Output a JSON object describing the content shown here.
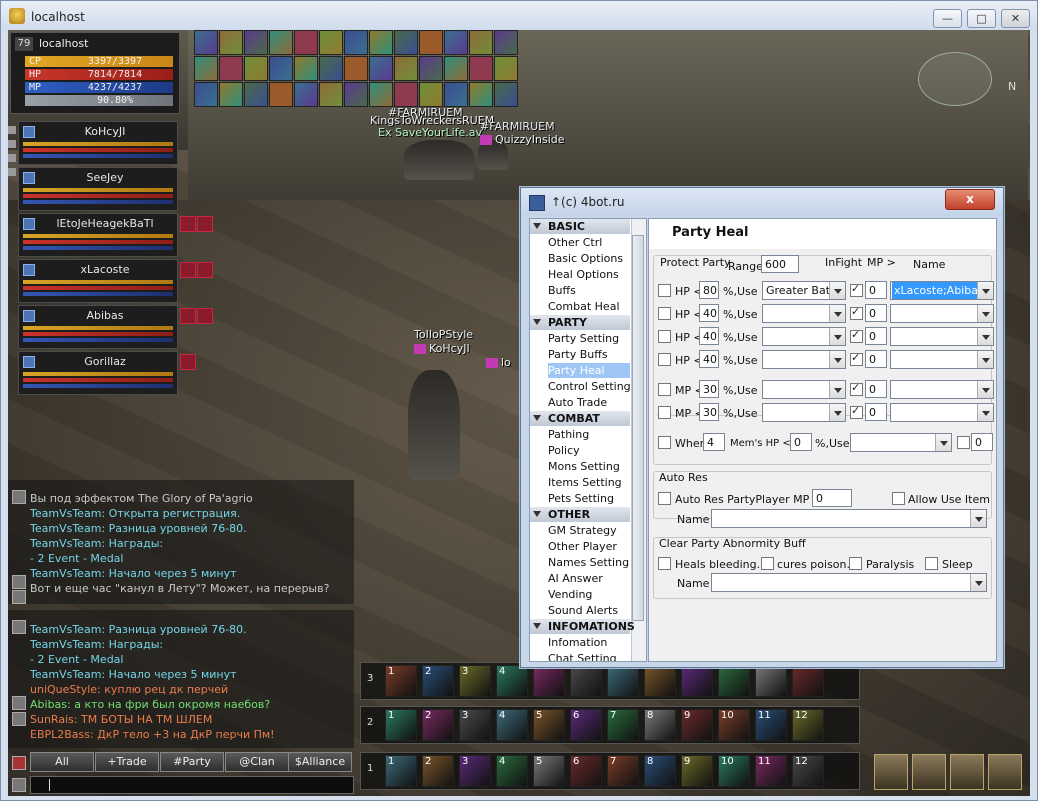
{
  "window": {
    "title": "localhost"
  },
  "status": {
    "level": "79",
    "name": "localhost",
    "cp": {
      "label": "CP",
      "value": "3397/3397"
    },
    "hp": {
      "label": "HP",
      "value": "7814/7814"
    },
    "mp": {
      "label": "MP",
      "value": "4237/4237"
    },
    "exp": {
      "value": "90.80%"
    }
  },
  "party": [
    {
      "name": "KoHcyJI"
    },
    {
      "name": "SeeJey"
    },
    {
      "name": "lEtoJeHeagekBaTl"
    },
    {
      "name": "xLacoste"
    },
    {
      "name": "Abibas"
    },
    {
      "name": "Gorillaz"
    }
  ],
  "world_tags": {
    "t1": "#FARMIRUEM",
    "t2": "KingsToWreckersRUEM",
    "t3": "#FARMIRUEM",
    "t4": "SaveYourLife.av",
    "t5": "QuizzyInside",
    "t6": "ToIIoPStyle",
    "t7": "KoHcyJI",
    "t8": "lo",
    "t9": "Ex"
  },
  "compass": "N",
  "chat_top": [
    {
      "text": "Вы под эффектом The Glory of Pa'agrio",
      "color": "#c9c9c9"
    },
    {
      "text": "TeamVsTeam: Открыта регистрация.",
      "color": "#74d6e8"
    },
    {
      "text": "TeamVsTeam: Разница уровней 76-80.",
      "color": "#74d6e8"
    },
    {
      "text": "TeamVsTeam: Награды:",
      "color": "#74d6e8"
    },
    {
      "text": " - 2 Event - Medal",
      "color": "#74d6e8"
    },
    {
      "text": "TeamVsTeam: Начало через 5 минут",
      "color": "#74d6e8"
    },
    {
      "text": "Вот и еще час \"канул в Лету\"? Может, на перерыв?",
      "color": "#c9c9c9"
    }
  ],
  "chat_bottom": [
    {
      "text": "TeamVsTeam: Разница уровней 76-80.",
      "color": "#74d6e8"
    },
    {
      "text": "TeamVsTeam: Награды:",
      "color": "#74d6e8"
    },
    {
      "text": " - 2 Event - Medal",
      "color": "#74d6e8"
    },
    {
      "text": "TeamVsTeam: Начало через 5 минут",
      "color": "#74d6e8"
    },
    {
      "text": "uniQueStyle: куплю рец дк перчей",
      "color": "#ec7c4c"
    },
    {
      "text": "Abibas: а кто на фри был окромя наебов?",
      "color": "#6fe06f"
    },
    {
      "text": "SunRais: ТМ БОТЫ НА ТМ ШЛЕМ",
      "color": "#ec7c4c"
    },
    {
      "text": "EBPL2Bass: ДкР тело +3 на ДкР перчи Пм!",
      "color": "#ec7c4c"
    }
  ],
  "chat_tabs": [
    "All",
    "+Trade",
    "#Party",
    "@Clan",
    "$Alliance"
  ],
  "hotbars": [
    {
      "row": "3",
      "slots": [
        "1",
        "2",
        "3",
        "4",
        "",
        "",
        "",
        "",
        "",
        "",
        "",
        ""
      ]
    },
    {
      "row": "2",
      "slots": [
        "1",
        "2",
        "3",
        "4",
        "5",
        "6",
        "7",
        "8",
        "9",
        "10",
        "11",
        "12"
      ]
    },
    {
      "row": "1",
      "slots": [
        "1",
        "2",
        "3",
        "4",
        "5",
        "6",
        "7",
        "8",
        "9",
        "10",
        "11",
        "12"
      ]
    }
  ],
  "bot": {
    "title": "↑(c) 4bot.ru",
    "close": "x",
    "nav": [
      {
        "type": "section",
        "label": "BASIC"
      },
      {
        "type": "item",
        "label": "Other Ctrl"
      },
      {
        "type": "item",
        "label": "Basic Options"
      },
      {
        "type": "item",
        "label": "Heal Options"
      },
      {
        "type": "item",
        "label": "Buffs"
      },
      {
        "type": "item",
        "label": "Combat Heal"
      },
      {
        "type": "section",
        "label": "PARTY"
      },
      {
        "type": "item",
        "label": "Party Setting"
      },
      {
        "type": "item",
        "label": "Party Buffs"
      },
      {
        "type": "item",
        "label": "Party Heal",
        "selected": true
      },
      {
        "type": "item",
        "label": "Control Setting"
      },
      {
        "type": "item",
        "label": "Auto Trade"
      },
      {
        "type": "section",
        "label": "COMBAT"
      },
      {
        "type": "item",
        "label": "Pathing"
      },
      {
        "type": "item",
        "label": "Policy"
      },
      {
        "type": "item",
        "label": "Mons Setting"
      },
      {
        "type": "item",
        "label": "Items Setting"
      },
      {
        "type": "item",
        "label": "Pets Setting"
      },
      {
        "type": "section",
        "label": "OTHER"
      },
      {
        "type": "item",
        "label": "GM Strategy"
      },
      {
        "type": "item",
        "label": "Other Player"
      },
      {
        "type": "item",
        "label": "Names Setting"
      },
      {
        "type": "item",
        "label": "AI Answer"
      },
      {
        "type": "item",
        "label": "Vending"
      },
      {
        "type": "item",
        "label": "Sound Alerts"
      },
      {
        "type": "section",
        "label": "INFOMATIONS"
      },
      {
        "type": "item",
        "label": "Infomation"
      },
      {
        "type": "item",
        "label": "Chat Setting"
      }
    ],
    "heading": "Party Heal",
    "protect": {
      "group_label": "Protect Party",
      "range_label": "Range",
      "range_value": "600",
      "infight_label": "InFight",
      "mp_col_label": "MP >",
      "name_col_label": "Name",
      "rows": [
        {
          "kind": "HP <",
          "pct": "80",
          "use": "%,Use",
          "skill": "Greater Battl",
          "infight": true,
          "mp": "0",
          "name": "xLacoste;Abibas;",
          "checked": false
        },
        {
          "kind": "HP <",
          "pct": "40",
          "use": "%,Use",
          "skill": "",
          "infight": true,
          "mp": "0",
          "name": "",
          "checked": false
        },
        {
          "kind": "HP <",
          "pct": "40",
          "use": "%,Use",
          "skill": "",
          "infight": true,
          "mp": "0",
          "name": "",
          "checked": false
        },
        {
          "kind": "HP <",
          "pct": "40",
          "use": "%,Use",
          "skill": "",
          "infight": true,
          "mp": "0",
          "name": "",
          "checked": false
        },
        {
          "kind": "MP <",
          "pct": "30",
          "use": "%,Use",
          "skill": "",
          "infight": true,
          "mp": "0",
          "name": "",
          "checked": false
        },
        {
          "kind": "MP <",
          "pct": "30",
          "use": "%,Use",
          "skill": "",
          "infight": true,
          "mp": "0",
          "name": "",
          "checked": false
        }
      ],
      "when": {
        "label": "When",
        "count": "4",
        "mems_label": "Mem's HP <",
        "pct": "0",
        "use": "%,Use",
        "skill": "",
        "extra": "0"
      }
    },
    "auto_res": {
      "group_label": "Auto Res",
      "check_label": "Auto Res PartyPlayer MP >",
      "mp_value": "0",
      "allow_label": "Allow Use Item",
      "name_label": "Name",
      "name_value": ""
    },
    "abnormity": {
      "group_label": "Clear Party Abnormity Buff",
      "options": [
        "Heals bleeding.",
        "cures poison.",
        "Paralysis",
        "Sleep"
      ],
      "name_label": "Name",
      "name_value": ""
    }
  }
}
